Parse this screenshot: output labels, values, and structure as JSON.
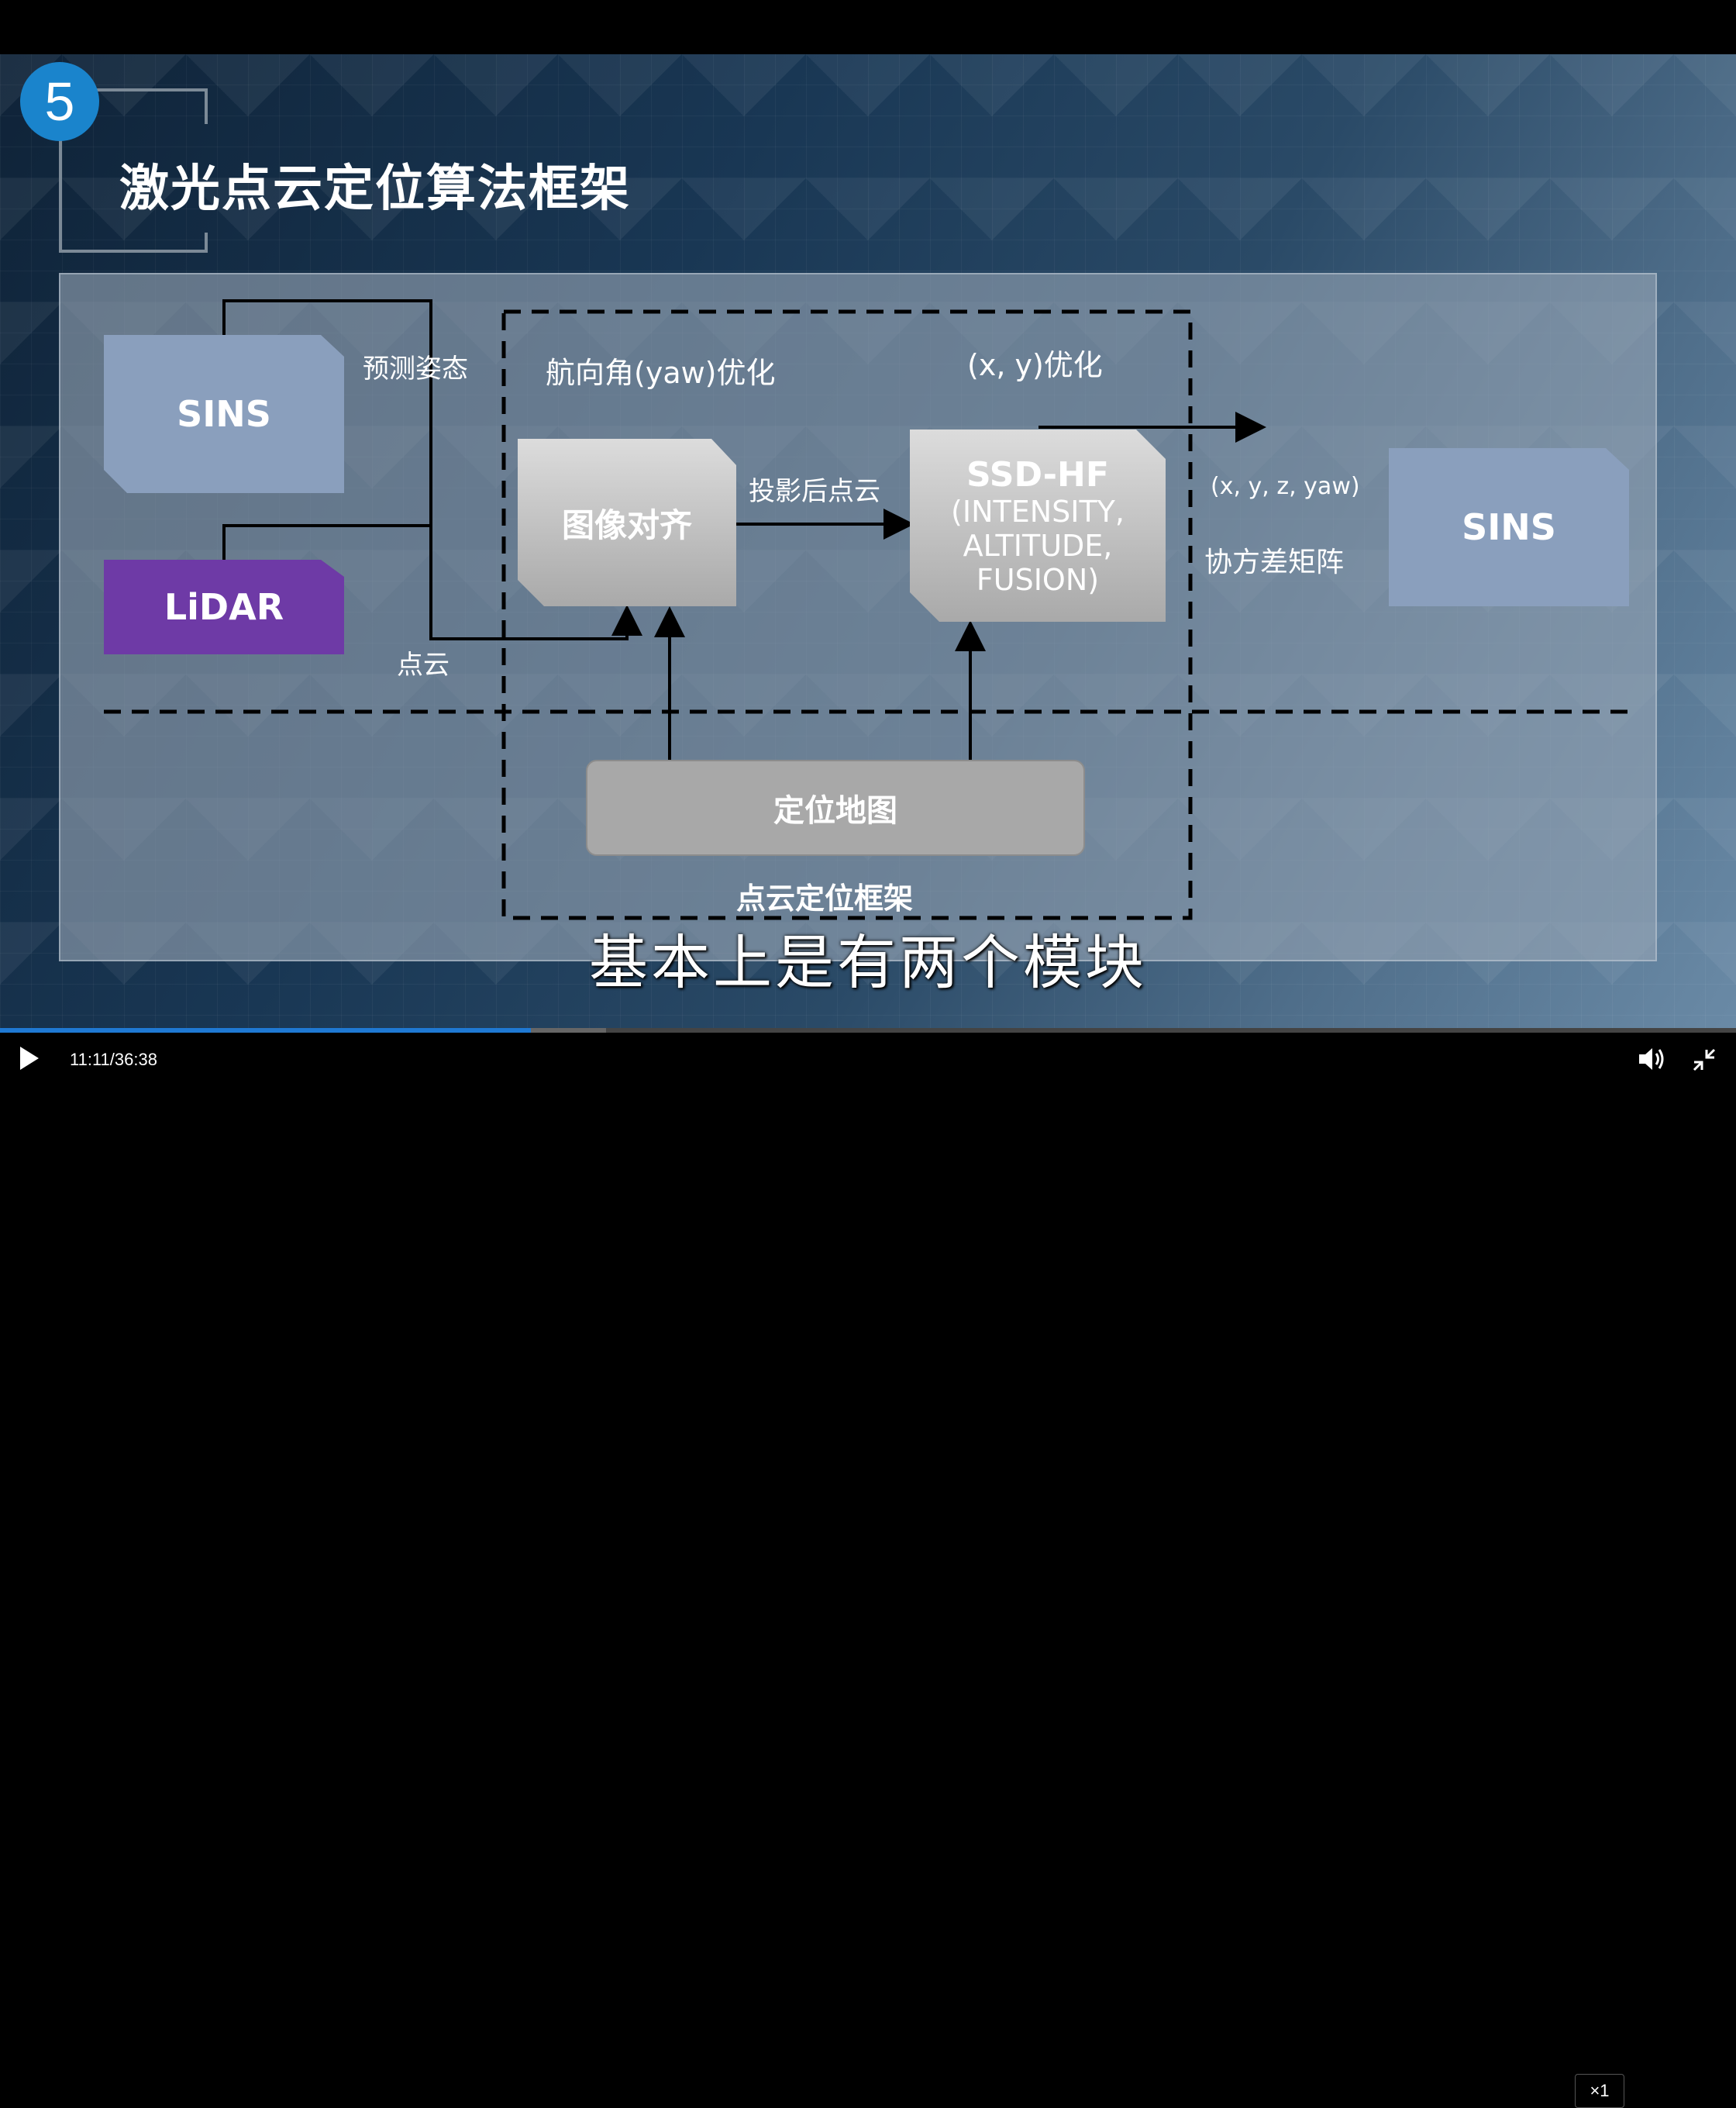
{
  "slide": {
    "number": "5",
    "title": "激光点云定位算法框架",
    "boxes": {
      "sins_left": "SINS",
      "lidar": "LiDAR",
      "image_align": "图像对齐",
      "ssd_hf_title": "SSD-HF",
      "ssd_hf_line1": "(INTENSITY,",
      "ssd_hf_line2": "ALTITUDE,",
      "ssd_hf_line3": "FUSION)",
      "sins_right": "SINS",
      "loc_map": "定位地图"
    },
    "labels": {
      "predicted_attitude": "预测姿态",
      "point_cloud": "点云",
      "yaw_opt": "航向角(yaw)优化",
      "xy_opt": "(x, y)优化",
      "projected_cloud": "投影后点云",
      "output_state": "(x, y, z, yaw)",
      "covariance": "协方差矩阵",
      "framework": "点云定位框架"
    },
    "colors": {
      "sins": "#8a9fbd",
      "lidar": "#6e3aa6",
      "gray_box": "#b9b9b9",
      "badge": "#1a84cc"
    }
  },
  "subtitle": "基本上是有两个模块",
  "player": {
    "play_icon": "play-icon",
    "current_time": "11:11",
    "separator": "/",
    "duration": "36:38",
    "played_fraction": 0.306,
    "buffered_fraction": 0.349,
    "speed": "×1",
    "volume_icon": "volume-icon",
    "fullscreen_icon": "exit-fullscreen-icon"
  }
}
